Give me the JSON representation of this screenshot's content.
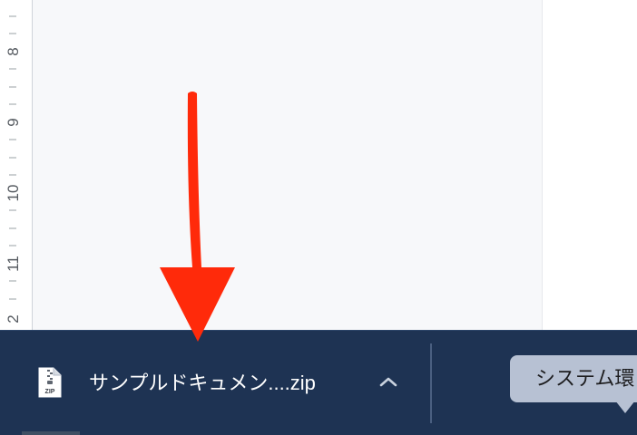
{
  "ruler": {
    "labels": [
      "8",
      "9",
      "10",
      "11",
      "2"
    ]
  },
  "download_bar": {
    "file": {
      "icon": "zip-file-icon",
      "icon_text": "ZIP",
      "name": "サンプルドキュメン....zip"
    },
    "menu_icon": "chevron-up-icon"
  },
  "tooltip": {
    "text": "システム環"
  },
  "annotation": {
    "icon": "red-arrow-down-icon",
    "color": "#ff2a0a"
  },
  "colors": {
    "bar_background": "#1e3353",
    "tooltip_background": "#b7c1d3",
    "document_background": "#f7f8fa"
  }
}
